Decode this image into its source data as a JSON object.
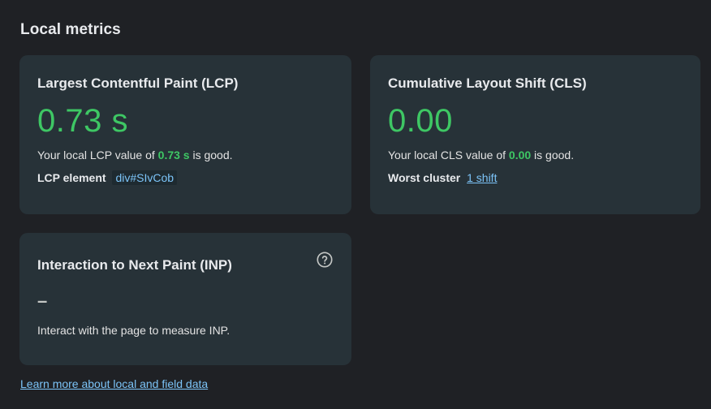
{
  "section": {
    "title": "Local metrics"
  },
  "lcp": {
    "title": "Largest Contentful Paint (LCP)",
    "value": "0.73 s",
    "desc_prefix": "Your local LCP value of ",
    "desc_value": "0.73 s",
    "desc_suffix": " is good.",
    "detail_label": "LCP element",
    "element_link": "div#SIvCob"
  },
  "cls": {
    "title": "Cumulative Layout Shift (CLS)",
    "value": "0.00",
    "desc_prefix": "Your local CLS value of ",
    "desc_value": "0.00",
    "desc_suffix": " is good.",
    "detail_label": "Worst cluster",
    "cluster_link": "1 shift"
  },
  "inp": {
    "title": "Interaction to Next Paint (INP)",
    "value": "–",
    "desc": "Interact with the page to measure INP.",
    "help_icon": "help-circle-icon"
  },
  "footer": {
    "learn_more": "Learn more about local and field data"
  },
  "colors": {
    "background": "#1f2125",
    "card": "#273238",
    "good": "#3ec764",
    "link": "#7cc4f8",
    "text": "#e3e3e3"
  }
}
